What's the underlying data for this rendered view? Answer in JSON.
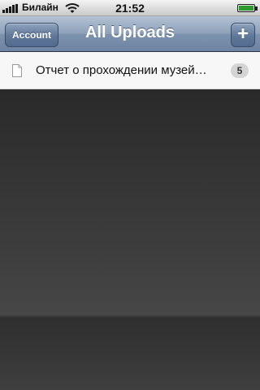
{
  "status_bar": {
    "carrier": "Билайн",
    "time": "21:52",
    "signal_bars": 5,
    "wifi_icon": "wifi-icon",
    "battery_icon": "battery-charging-icon"
  },
  "nav_bar": {
    "title": "All Uploads",
    "left_button_label": "Account",
    "right_button_label": "+",
    "right_button_icon": "plus-icon"
  },
  "uploads": [
    {
      "icon": "document-icon",
      "title": "Отчет о прохождении музей…",
      "count": "5"
    }
  ],
  "colors": {
    "nav_accent": "#6d84a2",
    "battery_charge": "#2f9c2f",
    "empty_background": "#3e3e3e"
  }
}
